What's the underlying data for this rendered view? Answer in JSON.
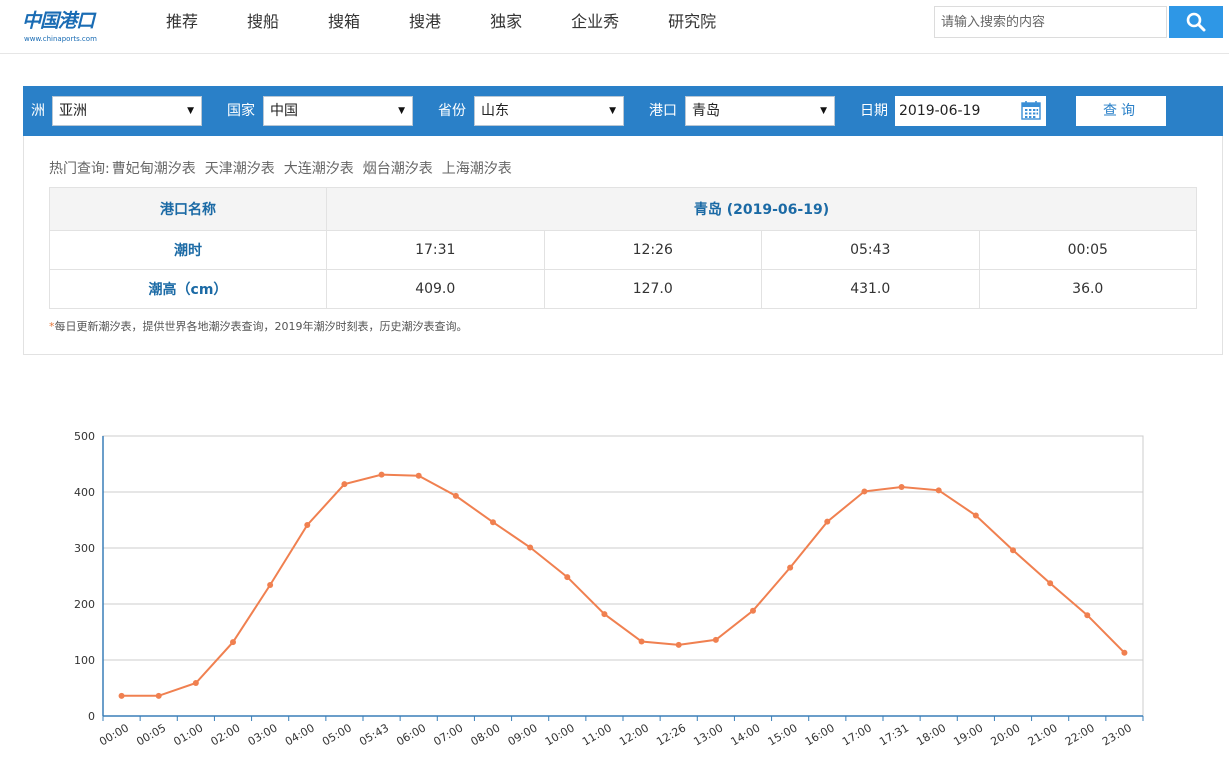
{
  "header": {
    "logo_text": "中国港口",
    "logo_url_text": "www.chinaports.com",
    "nav": [
      "推荐",
      "搜船",
      "搜箱",
      "搜港",
      "独家",
      "企业秀",
      "研究院"
    ],
    "search_placeholder": "请输入搜索的内容",
    "search_icon": "magnifier-icon"
  },
  "filters": {
    "continent_label": "洲",
    "continent_value": "亚洲",
    "country_label": "国家",
    "country_value": "中国",
    "province_label": "省份",
    "province_value": "山东",
    "port_label": "港口",
    "port_value": "青岛",
    "date_label": "日期",
    "date_value": "2019-06-19",
    "query_button": "查询",
    "accent_color": "#2a80c8"
  },
  "hot_queries": {
    "label": "热门查询:",
    "links": [
      "曹妃甸潮汐表",
      "天津潮汐表",
      "大连潮汐表",
      "烟台潮汐表",
      "上海潮汐表"
    ]
  },
  "tide_table": {
    "port_name_header": "港口名称",
    "title": "青岛 (2019-06-19)",
    "time_label": "潮时",
    "times": [
      "17:31",
      "12:26",
      "05:43",
      "00:05"
    ],
    "height_label": "潮高（cm）",
    "heights": [
      "409.0",
      "127.0",
      "431.0",
      "36.0"
    ]
  },
  "note": {
    "star": "*",
    "text": "每日更新潮汐表，提供世界各地潮汐表查询，2019年潮汐时刻表，历史潮汐表查询。"
  },
  "chart_data": {
    "type": "line",
    "title": "",
    "xlabel": "",
    "ylabel": "",
    "ylim": [
      0,
      500
    ],
    "yticks": [
      0,
      100,
      200,
      300,
      400,
      500
    ],
    "grid": true,
    "line_color": "#f08050",
    "categories": [
      "00:00",
      "00:05",
      "01:00",
      "02:00",
      "03:00",
      "04:00",
      "05:00",
      "05:43",
      "06:00",
      "07:00",
      "08:00",
      "09:00",
      "10:00",
      "11:00",
      "12:00",
      "12:26",
      "13:00",
      "14:00",
      "15:00",
      "16:00",
      "17:00",
      "17:31",
      "18:00",
      "19:00",
      "20:00",
      "21:00",
      "22:00",
      "23:00"
    ],
    "values": [
      36,
      36,
      59,
      132,
      234,
      341,
      414,
      431,
      429,
      393,
      346,
      301,
      248,
      182,
      133,
      127,
      136,
      188,
      265,
      347,
      401,
      409,
      403,
      358,
      296,
      237,
      180,
      113
    ]
  }
}
